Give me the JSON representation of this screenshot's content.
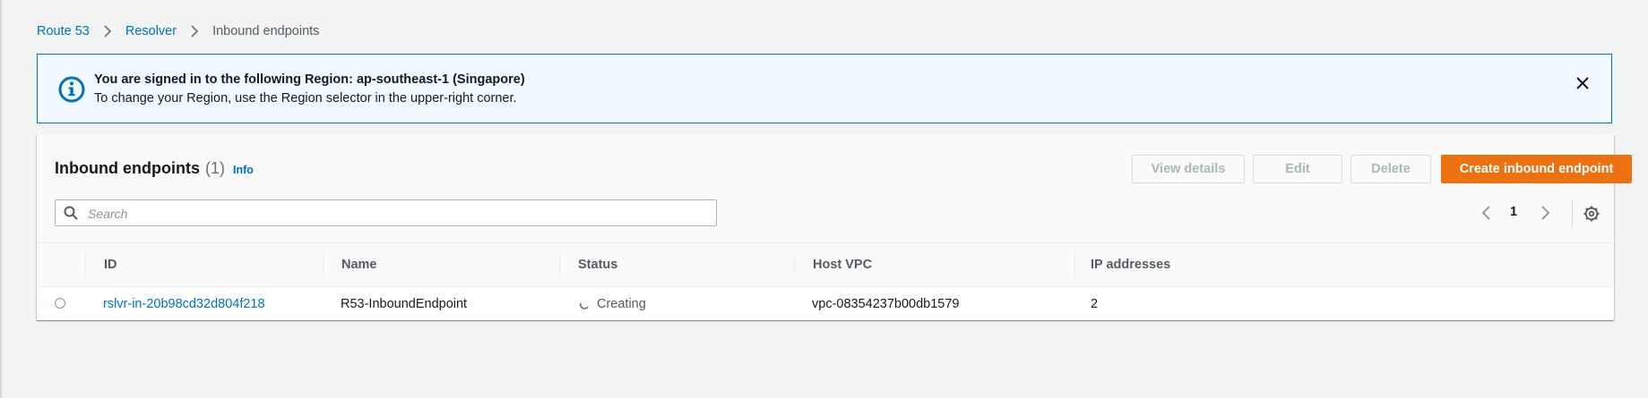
{
  "breadcrumb": {
    "items": [
      "Route 53",
      "Resolver"
    ],
    "current": "Inbound endpoints"
  },
  "flash": {
    "title": "You are signed in to the following Region: ap-southeast-1 (Singapore)",
    "text": "To change your Region, use the Region selector in the upper-right corner.",
    "icon": "info-circle-icon",
    "color": "#0073bb"
  },
  "panel": {
    "title": "Inbound endpoints",
    "count": "(1)",
    "info_label": "Info",
    "buttons": {
      "view_details": "View details",
      "edit": "Edit",
      "delete": "Delete",
      "create": "Create inbound endpoint"
    },
    "accent_color": "#ec7211"
  },
  "search": {
    "placeholder": "Search",
    "value": ""
  },
  "pagination": {
    "current_page": "1"
  },
  "table": {
    "columns": [
      "ID",
      "Name",
      "Status",
      "Host VPC",
      "IP addresses"
    ],
    "rows": [
      {
        "id": "rslvr-in-20b98cd32d804f218",
        "name": "R53-InboundEndpoint",
        "status": "Creating",
        "host_vpc": "vpc-08354237b00db1579",
        "ip_addresses": "2"
      }
    ]
  }
}
